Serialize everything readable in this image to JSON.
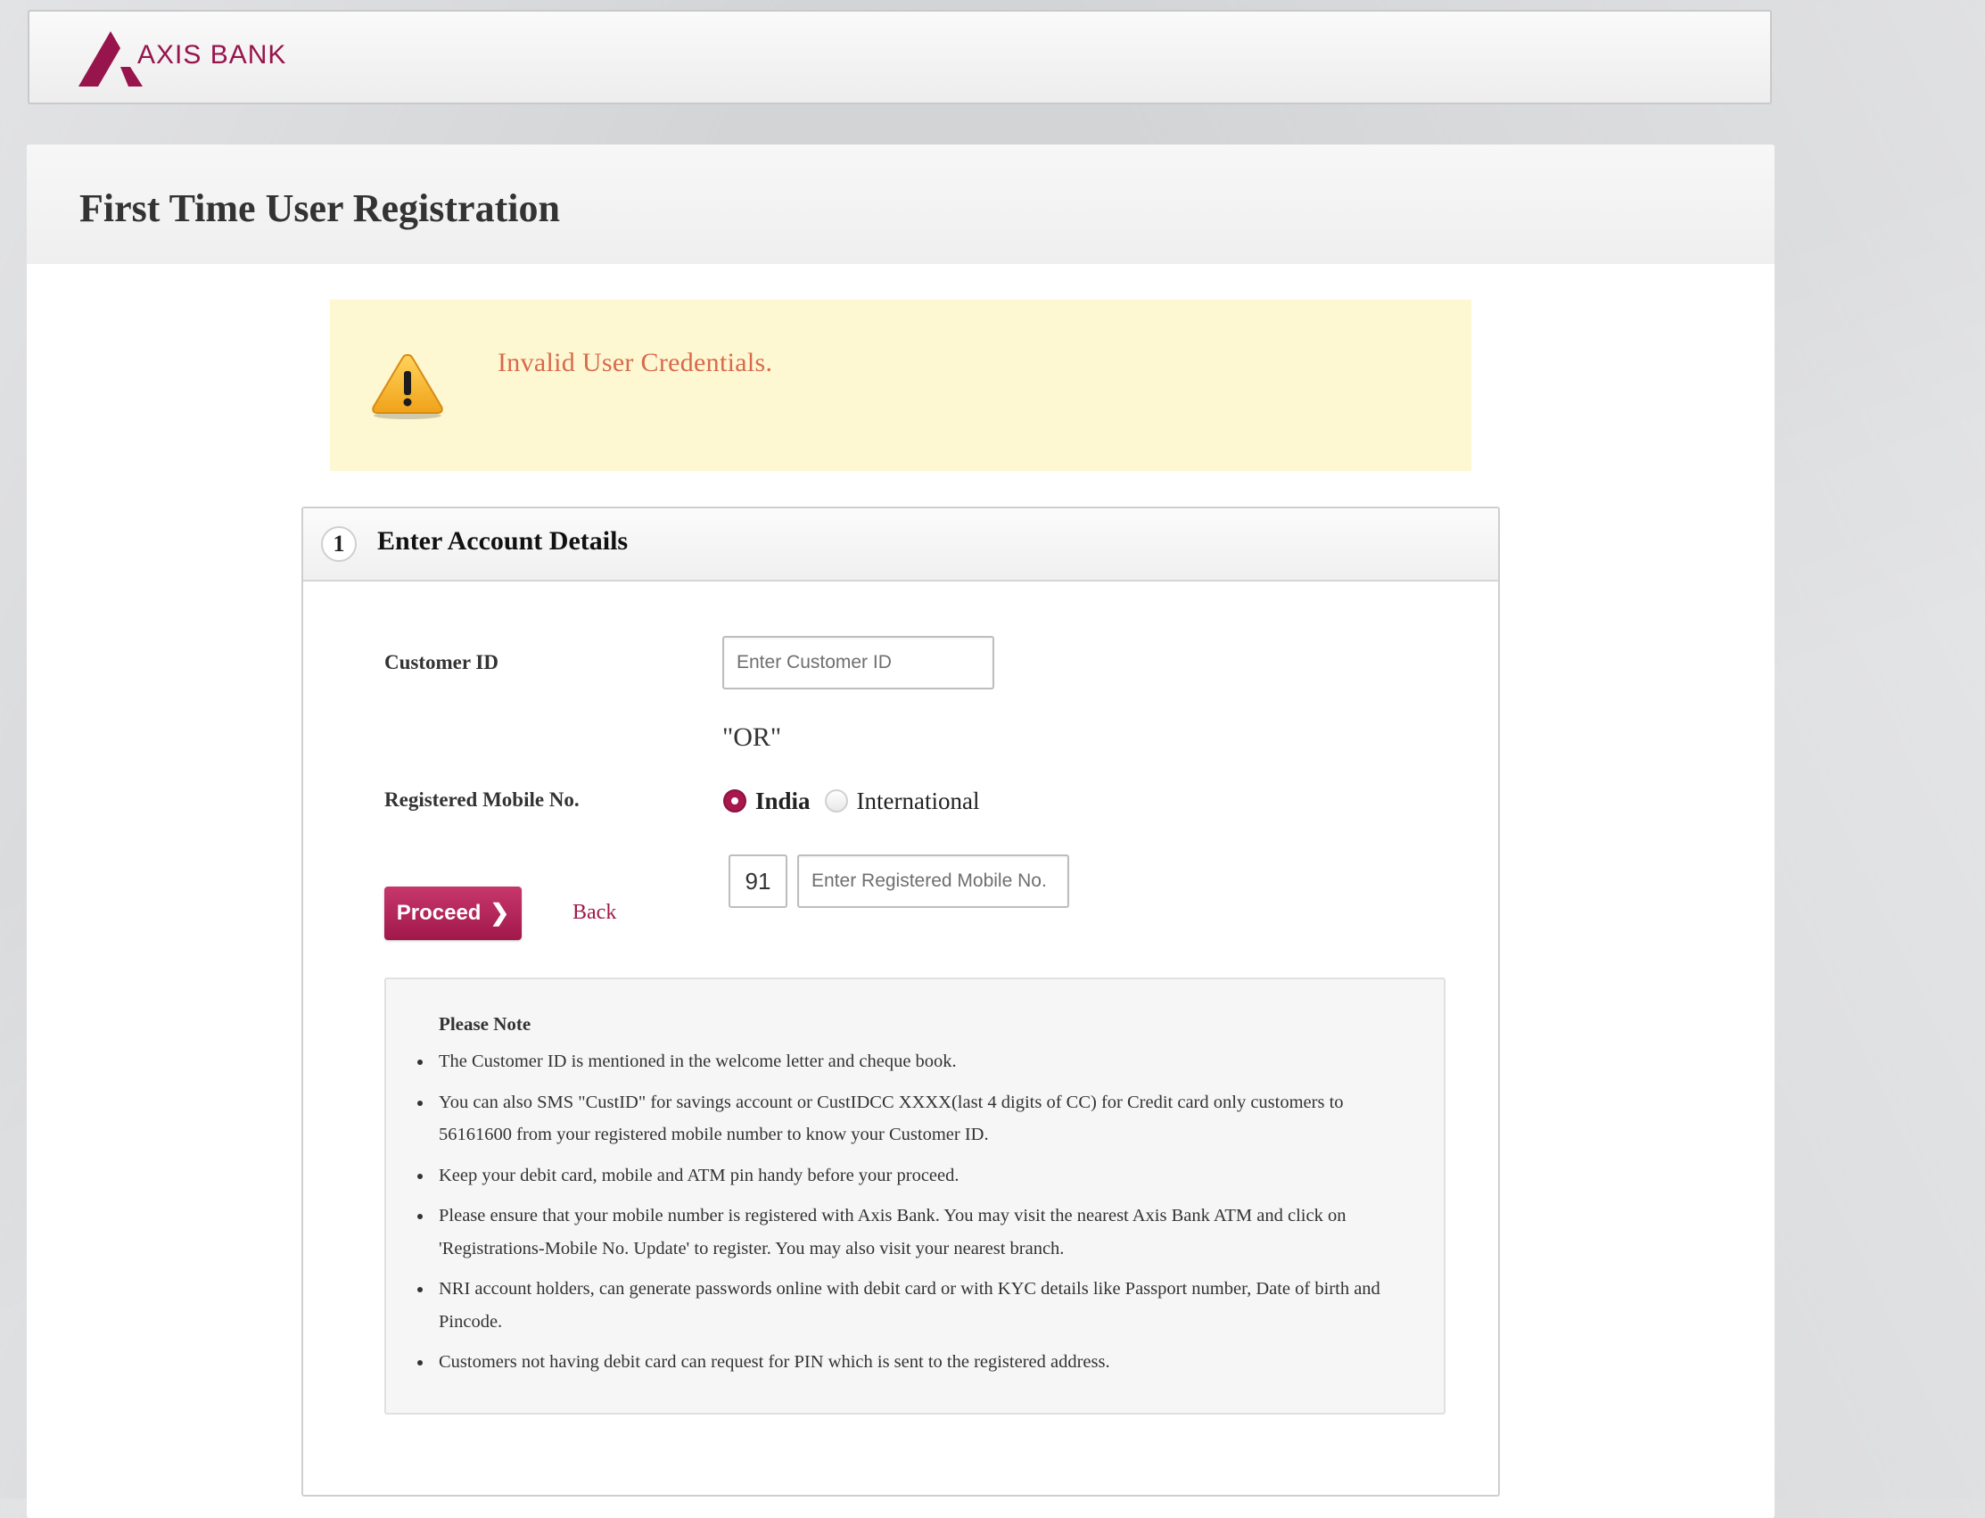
{
  "brand": {
    "name": "AXIS BANK",
    "color": "#97144d"
  },
  "page": {
    "title": "First Time User Registration"
  },
  "alert": {
    "icon": "warning-icon",
    "message": "Invalid User Credentials."
  },
  "section": {
    "step": "1",
    "title": "Enter Account Details"
  },
  "form": {
    "customer_id_label": "Customer ID",
    "customer_id_placeholder": "Enter Customer ID",
    "customer_id_value": "",
    "or_text": "\"OR\"",
    "mobile_label": "Registered Mobile No.",
    "options": [
      {
        "label": "India",
        "selected": true
      },
      {
        "label": "International",
        "selected": false
      }
    ],
    "country_code": "91",
    "mobile_placeholder": "Enter Registered Mobile No.",
    "mobile_value": "",
    "proceed_label": "Proceed",
    "proceed_icon": "chevron-right-icon",
    "back_label": "Back"
  },
  "note": {
    "title": "Please Note",
    "items": [
      "The Customer ID is mentioned in the welcome letter and cheque book.",
      "You can also SMS \"CustID\" for savings account or CustIDCC XXXX(last 4 digits of CC) for Credit card only customers to 56161600 from your registered mobile number to know your Customer ID.",
      "Keep your debit card, mobile and ATM pin handy before your proceed.",
      "Please ensure that your mobile number is registered with Axis Bank. You may visit the nearest Axis Bank ATM and click on 'Registrations-Mobile No. Update' to register. You may also visit your nearest branch.",
      "NRI account holders, can generate passwords online with debit card or with KYC details like Passport number, Date of birth and Pincode.",
      "Customers not having debit card can request for PIN which is sent to the registered address."
    ]
  },
  "colors": {
    "accent": "#a1184b",
    "alert_bg": "#fdf7d2",
    "alert_text": "#d9694b"
  }
}
